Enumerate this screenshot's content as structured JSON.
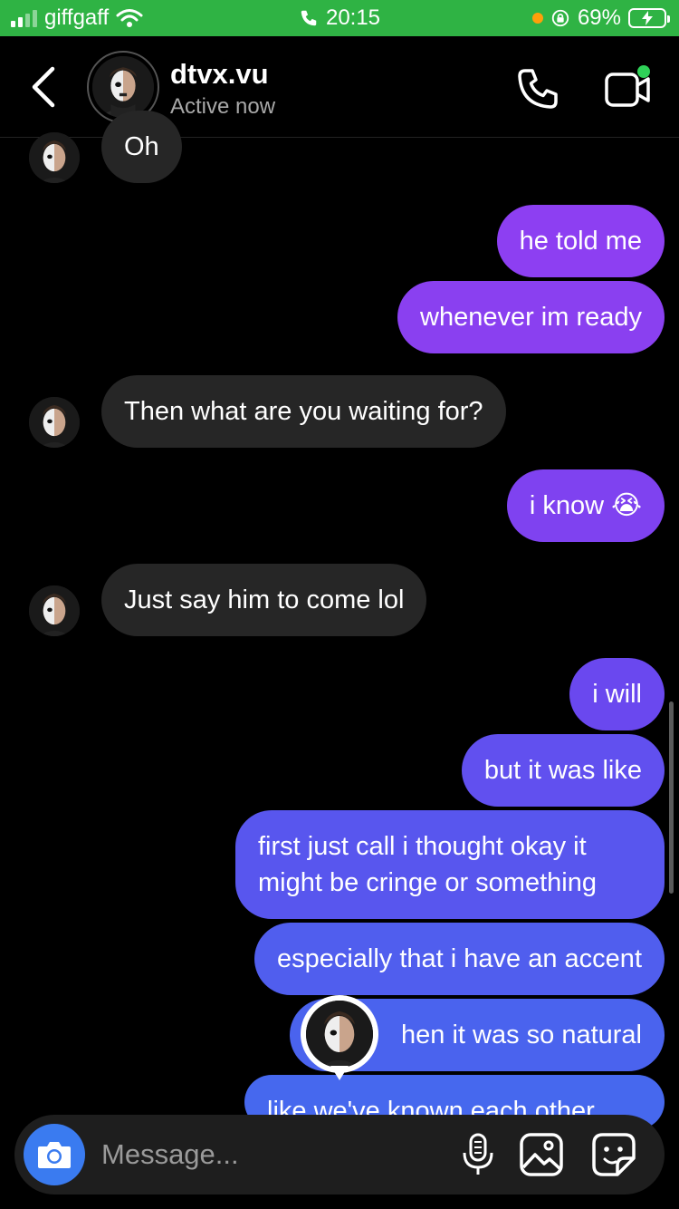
{
  "status_bar": {
    "carrier": "giffgaff",
    "time": "20:15",
    "battery": "69%"
  },
  "header": {
    "username": "dtvx.vu",
    "status": "Active now"
  },
  "messages": [
    {
      "side": "in",
      "text": "Oh"
    },
    {
      "side": "out",
      "text": "he told me"
    },
    {
      "side": "out",
      "text": "whenever im ready"
    },
    {
      "side": "in",
      "text": "Then what are you waiting for?"
    },
    {
      "side": "out",
      "text": "i know 😭"
    },
    {
      "side": "in",
      "text": "Just say him to come lol"
    },
    {
      "side": "out",
      "text": "i will"
    },
    {
      "side": "out",
      "text": "but it was like"
    },
    {
      "side": "out",
      "text": "first just call i thought okay it might be cringe or something"
    },
    {
      "side": "out",
      "text": "especially that i have an accent"
    },
    {
      "side": "out",
      "text": "hen it was so natural"
    },
    {
      "side": "out",
      "text": "like we've known each other"
    }
  ],
  "composer": {
    "placeholder": "Message..."
  },
  "colors": {
    "status_green": "#2fb344",
    "incoming_bubble": "#262626",
    "outgoing_purple": "#8a3ff0",
    "outgoing_blue": "#4a63ee",
    "camera_blue": "#3a7bf0"
  }
}
